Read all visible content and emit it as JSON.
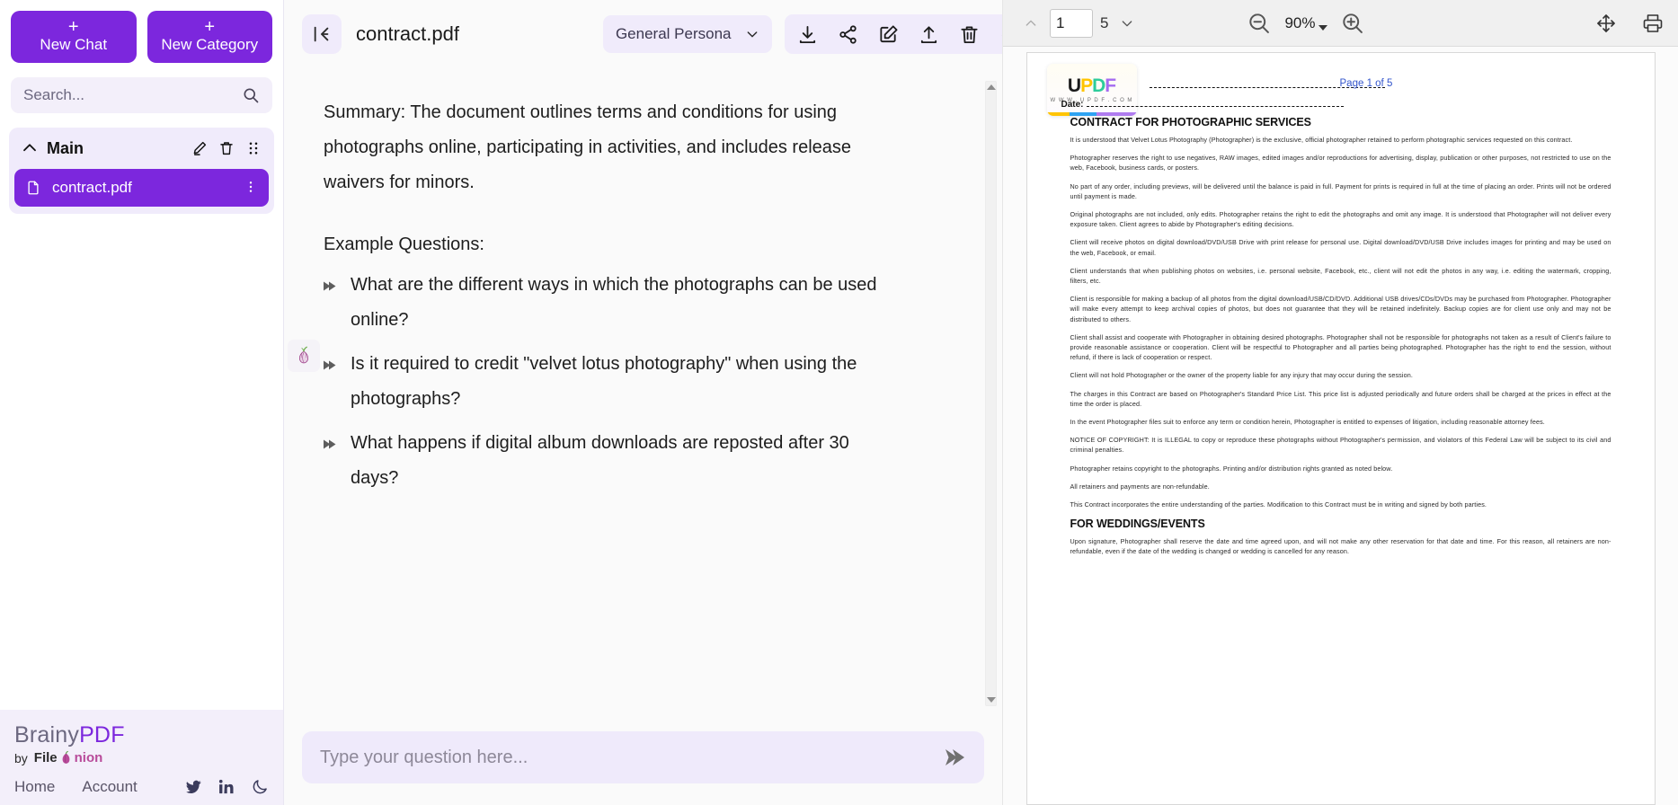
{
  "sidebar": {
    "new_chat_label": "New Chat",
    "new_category_label": "New Category",
    "plus_glyph": "+",
    "search_placeholder": "Search...",
    "search_value": "",
    "category": {
      "title": "Main",
      "edit_icon": "pencil-icon",
      "delete_icon": "trash-icon",
      "drag_icon": "grid-drag-icon",
      "chevron_icon": "chevron-up-icon"
    },
    "documents": [
      {
        "name": "contract.pdf",
        "icon": "file-document-icon",
        "menu_icon": "kebab-menu-icon",
        "selected": true
      }
    ],
    "footer": {
      "brand_prefix": "Brainy",
      "brand_suffix": "PDF",
      "by_text": "by",
      "company_prefix": "File",
      "company_suffix": "nion",
      "links": [
        {
          "label": "Home"
        },
        {
          "label": "Account"
        }
      ],
      "social": [
        {
          "icon": "twitter-icon"
        },
        {
          "icon": "linkedin-icon"
        },
        {
          "icon": "moon-dark-mode-icon"
        }
      ]
    }
  },
  "chat": {
    "collapse_icon": "collapse-sidebar-icon",
    "file_title": "contract.pdf",
    "persona": {
      "selected": "General Persona",
      "chevron": "chevron-down-icon"
    },
    "tools": [
      {
        "icon": "download-icon"
      },
      {
        "icon": "share-icon"
      },
      {
        "icon": "edit-icon"
      },
      {
        "icon": "upload-icon"
      },
      {
        "icon": "trash-icon"
      },
      {
        "icon": "refresh-icon"
      }
    ],
    "message": {
      "avatar_icon": "onion-avatar-icon",
      "summary": "Summary: The document outlines terms and conditions for using photographs online, participating in activities, and includes release waivers for minors.",
      "questions_label": "Example Questions:",
      "questions": [
        "What are the different ways in which the photographs can be used online?",
        "Is it required to credit \"velvet lotus photography\" when using the photographs?",
        "What happens if digital album downloads are reposted after 30 days?"
      ]
    },
    "input": {
      "placeholder": "Type your question here...",
      "value": "",
      "send_icon": "send-arrow-icon"
    }
  },
  "pdf_viewer": {
    "toolbar": {
      "page_up_icon": "chevron-up-icon",
      "page_down_icon": "chevron-down-icon",
      "current_page": "1",
      "total_pages": "5",
      "zoom_out_icon": "zoom-out-icon",
      "zoom_in_icon": "zoom-in-icon",
      "zoom_level": "90%",
      "zoom_chevron_icon": "caret-down-icon",
      "pan_icon": "pan-move-icon",
      "print_icon": "print-icon"
    },
    "page": {
      "watermark": {
        "u_text": "U",
        "p_text": "P",
        "d_text": "D",
        "f_text": "F",
        "url": "W W W . U P D F . C O M"
      },
      "page_label_prefix": "Page",
      "page_label_value": "1 of 5",
      "date_label": "Date:",
      "heading_1": "CONTRACT FOR PHOTOGRAPHIC SERVICES",
      "paragraphs": [
        "It is understood that Velvet Lotus Photography (Photographer) is the exclusive, official photographer retained to perform photographic services requested on this contract.",
        "Photographer reserves the right to use negatives, RAW images, edited images and/or reproductions for advertising, display, publication or other purposes, not restricted to use on the web, Facebook, business cards, or posters.",
        "No part of any order, including previews, will be delivered until the balance is paid in full. Payment for prints is required in full at the time of placing an order. Prints will not be ordered until payment is made.",
        "Original photographs are not included, only edits. Photographer retains the right to edit the photographs and omit any image. It is understood that Photographer will not deliver every exposure taken. Client agrees to abide by Photographer's editing decisions.",
        "Client will receive photos on digital download/DVD/USB Drive with print release for personal use. Digital download/DVD/USB Drive includes images for printing and may be used on the web, Facebook, or email.",
        "Client understands that when publishing photos on websites, i.e. personal website, Facebook, etc., client will not edit the photos in any way, i.e. editing the watermark, cropping, filters, etc.",
        "Client is responsible for making a backup of all photos from the digital download/USB/CD/DVD. Additional USB drives/CDs/DVDs may be purchased from Photographer. Photographer will make every attempt to keep archival copies of photos, but does not guarantee that they will be retained indefinitely. Backup copies are for client use only and may not be distributed to others.",
        "Client shall assist and cooperate with Photographer in obtaining desired photographs. Photographer shall not be responsible for photographs not taken as a result of Client's failure to provide reasonable assistance or cooperation. Client will be respectful to Photographer and all parties being photographed. Photographer has the right to end the session, without refund, if there is lack of cooperation or respect.",
        "Client will not hold Photographer or the owner of the property liable for any injury that may occur during the session.",
        "The charges in this Contract are based on Photographer's Standard Price List. This price list is adjusted periodically and future orders shall be charged at the prices in effect at the time the order is placed.",
        "In the event Photographer files suit to enforce any term or condition herein, Photographer is entitled to expenses of litigation, including reasonable attorney fees.",
        "NOTICE OF COPYRIGHT: It is ILLEGAL to copy or reproduce these photographs without Photographer's permission, and violators of this Federal Law will be subject to its civil and criminal penalties.",
        "Photographer retains copyright to the photographs. Printing and/or distribution rights granted as noted below.",
        "All retainers and payments are non-refundable.",
        "This Contract incorporates the entire understanding of the parties. Modification to this Contract must be in writing and signed by both parties."
      ],
      "heading_2": "FOR WEDDINGS/EVENTS",
      "paragraphs_after": [
        "Upon signature, Photographer shall reserve the date and time agreed upon, and will not make any other reservation for that date and time. For this reason, all retainers are non-refundable, even if the date of the wedding is changed or wedding is cancelled for any reason."
      ]
    }
  },
  "colors": {
    "brand_purple": "#7c27dd",
    "light_purple": "#f0ebfb",
    "page_link_blue": "#3355cc",
    "onion_pink": "#b84b9a"
  }
}
